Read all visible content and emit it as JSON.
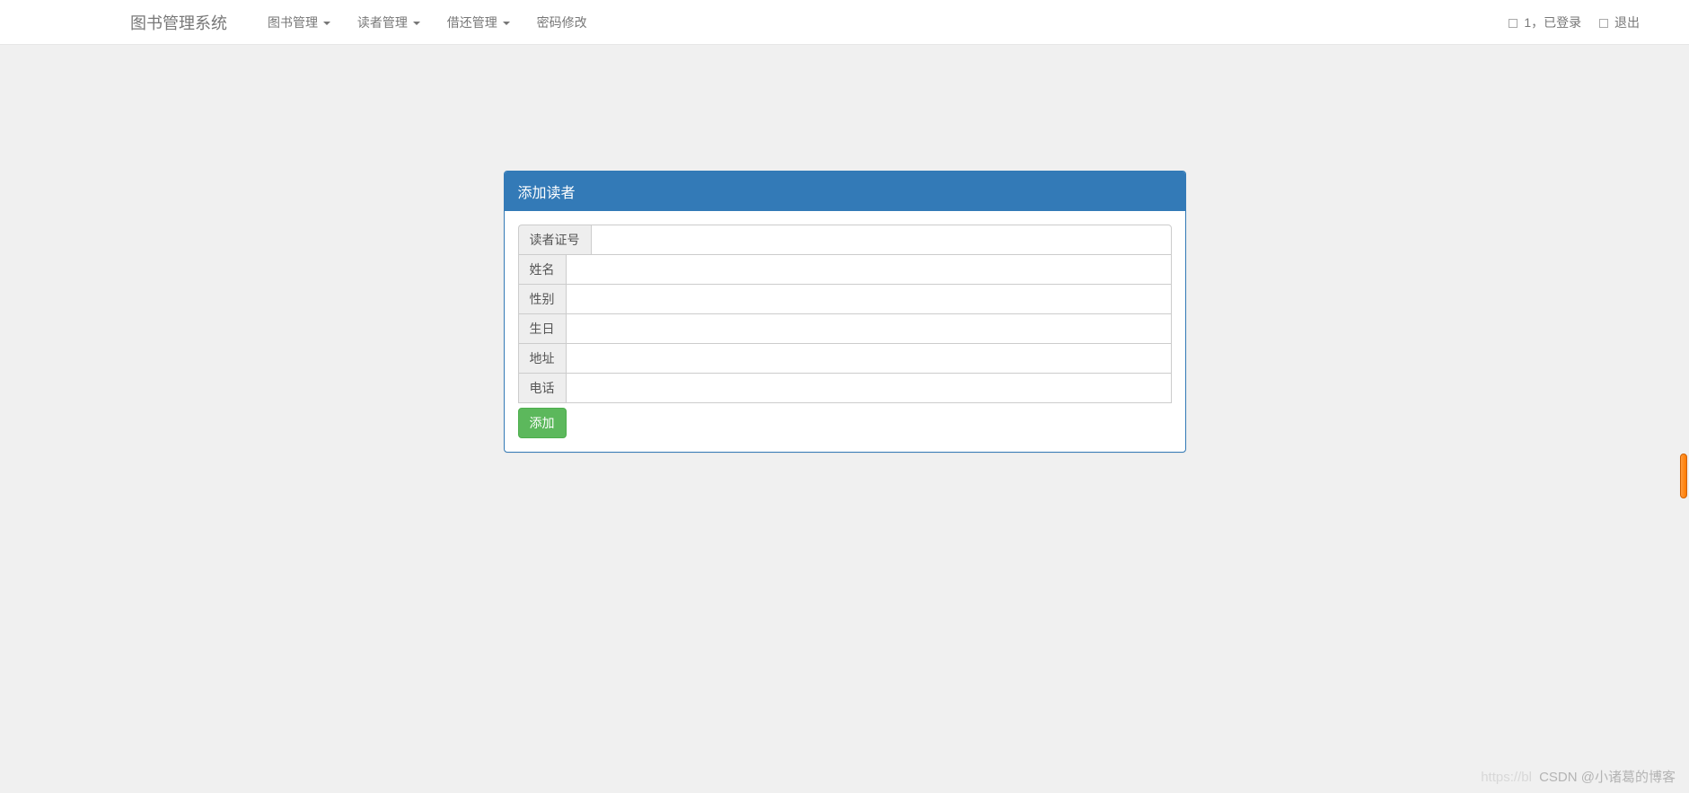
{
  "navbar": {
    "brand": "图书管理系统",
    "menus": [
      {
        "label": "图书管理",
        "dropdown": true
      },
      {
        "label": "读者管理",
        "dropdown": true
      },
      {
        "label": "借还管理",
        "dropdown": true
      },
      {
        "label": "密码修改",
        "dropdown": false
      }
    ],
    "user_status": "1，已登录",
    "logout": "退出"
  },
  "panel": {
    "title": "添加读者",
    "fields": [
      {
        "label": "读者证号",
        "value": ""
      },
      {
        "label": "姓名",
        "value": ""
      },
      {
        "label": "性别",
        "value": ""
      },
      {
        "label": "生日",
        "value": ""
      },
      {
        "label": "地址",
        "value": ""
      },
      {
        "label": "电话",
        "value": ""
      }
    ],
    "submit_label": "添加"
  },
  "watermark": {
    "faint": "https://bl",
    "text": "CSDN @小诸葛的博客"
  }
}
